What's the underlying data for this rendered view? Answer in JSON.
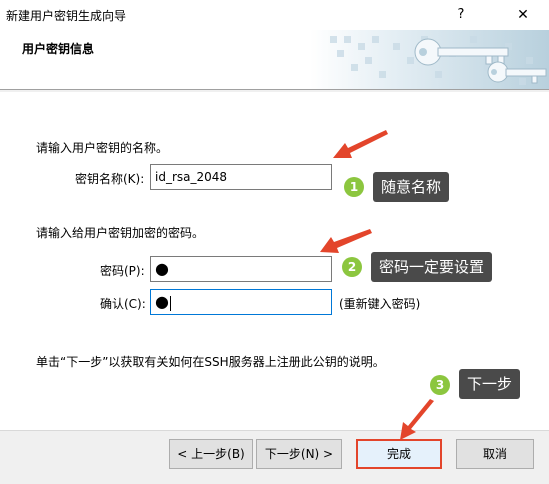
{
  "window": {
    "title": "新建用户密钥生成向导",
    "help_label": "?",
    "close_label": "✕"
  },
  "header": {
    "title": "用户密钥信息",
    "art_icon": "keys-icon"
  },
  "form": {
    "name_prompt": "请输入用户密钥的名称。",
    "name_label": "密钥名称(K):",
    "name_value": "id_rsa_2048",
    "password_prompt": "请输入给用户密钥加密的密码。",
    "password_label": "密码(P):",
    "password_value": "●",
    "confirm_label": "确认(C):",
    "confirm_value": "●",
    "confirm_hint": "(重新键入密码)",
    "info_text": "单击“下一步”以获取有关如何在SSH服务器上注册此公钥的说明。"
  },
  "buttons": {
    "back": "< 上一步(B)",
    "next": "下一步(N) >",
    "finish": "完成",
    "cancel": "取消"
  },
  "annotations": [
    {
      "number": "1",
      "text": "随意名称"
    },
    {
      "number": "2",
      "text": "密码一定要设置"
    },
    {
      "number": "3",
      "text": "下一步"
    }
  ],
  "colors": {
    "annotation_arrow": "#e3452b",
    "badge": "#8cc63f",
    "callout_bg": "#4a4a4a",
    "focus_border": "#0078d7"
  }
}
